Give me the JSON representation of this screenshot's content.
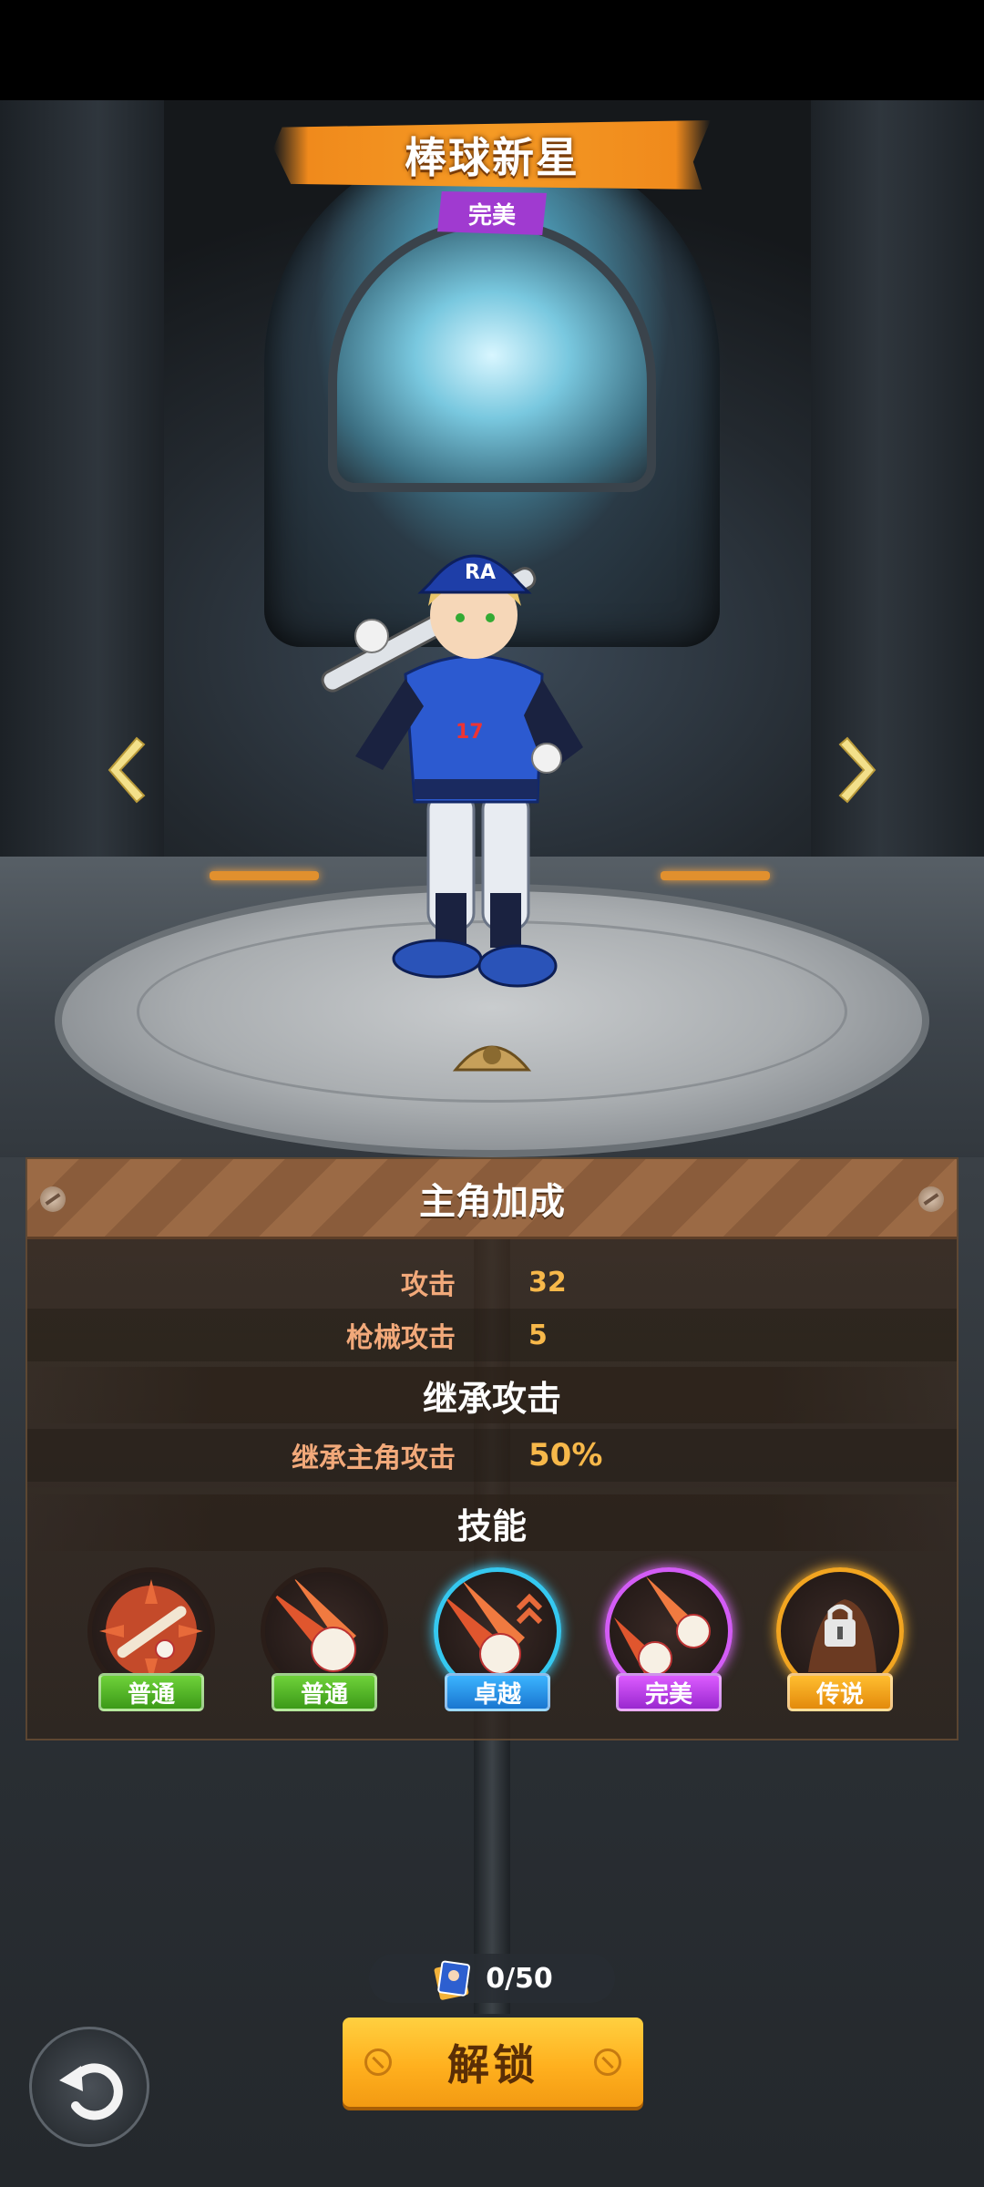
{
  "character": {
    "name": "棒球新星",
    "rarity": "完美"
  },
  "panel": {
    "title": "主角加成",
    "stats": [
      {
        "label": "攻击",
        "value": "32"
      },
      {
        "label": "枪械攻击",
        "value": "5"
      }
    ],
    "inherit_title": "继承攻击",
    "inherit": {
      "label": "继承主角攻击",
      "value": "50%"
    },
    "skills_title": "技能",
    "skills": [
      {
        "icon": "baseball-bat-icon",
        "tier": "普通",
        "color": "#4caf1f"
      },
      {
        "icon": "pitched-ball-icon",
        "tier": "普通",
        "color": "#4caf1f"
      },
      {
        "icon": "rising-ball-icon",
        "tier": "卓越",
        "color": "#1a8fe0"
      },
      {
        "icon": "double-ball-icon",
        "tier": "完美",
        "color": "#b23ee0"
      },
      {
        "icon": "locked-skill-icon",
        "tier": "传说",
        "color": "#f2a020"
      }
    ]
  },
  "progress": {
    "text": "0/50",
    "icon": "character-card-icon"
  },
  "unlock_button": "解锁",
  "colors": {
    "accent_orange": "#f59a24",
    "rarity_purple": "#a03ad0",
    "stat_label": "#f2a97a",
    "stat_value": "#f7b84a"
  }
}
